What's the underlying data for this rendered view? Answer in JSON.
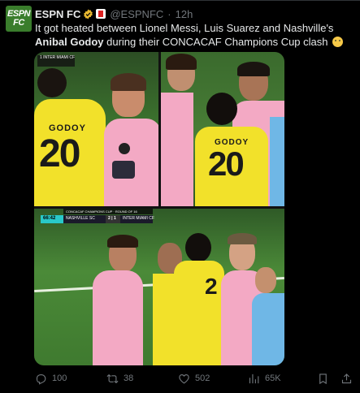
{
  "account": {
    "avatar_text_top": "ESPN",
    "avatar_text_bottom": "FC",
    "name": "ESPN FC",
    "handle": "@ESPNFC",
    "separator": "·",
    "time": "12h"
  },
  "tweet": {
    "text_part1": "It got heated between Lionel Messi, Luis Suarez and Nashville's ",
    "text_bold": "Anibal Godoy",
    "text_part2": " during their CONCACAF Champions Cup clash "
  },
  "media": {
    "photo1": {
      "jersey_name": "GODOY",
      "jersey_number": "20",
      "bug_left": "1",
      "bug_right": "INTER MIAMI CF"
    },
    "photo2": {
      "jersey_name": "GODOY",
      "jersey_number": "20"
    },
    "photo3": {
      "jersey_number": "2",
      "bug_header": "CONCACAF CHAMPIONS CUP · ROUND OF 16",
      "bug_time": "66:42",
      "bug_home": "NASHVILLE SC",
      "bug_score": "2 | 1",
      "bug_away": "INTER MIAMI CF"
    }
  },
  "actions": {
    "replies": "100",
    "retweets": "38",
    "likes": "502",
    "views": "65K"
  },
  "colors": {
    "accent_green": "#3a7d2c",
    "muted": "#71767b",
    "jersey_yellow": "#f2e12a",
    "jersey_pink": "#f3a9c4"
  }
}
